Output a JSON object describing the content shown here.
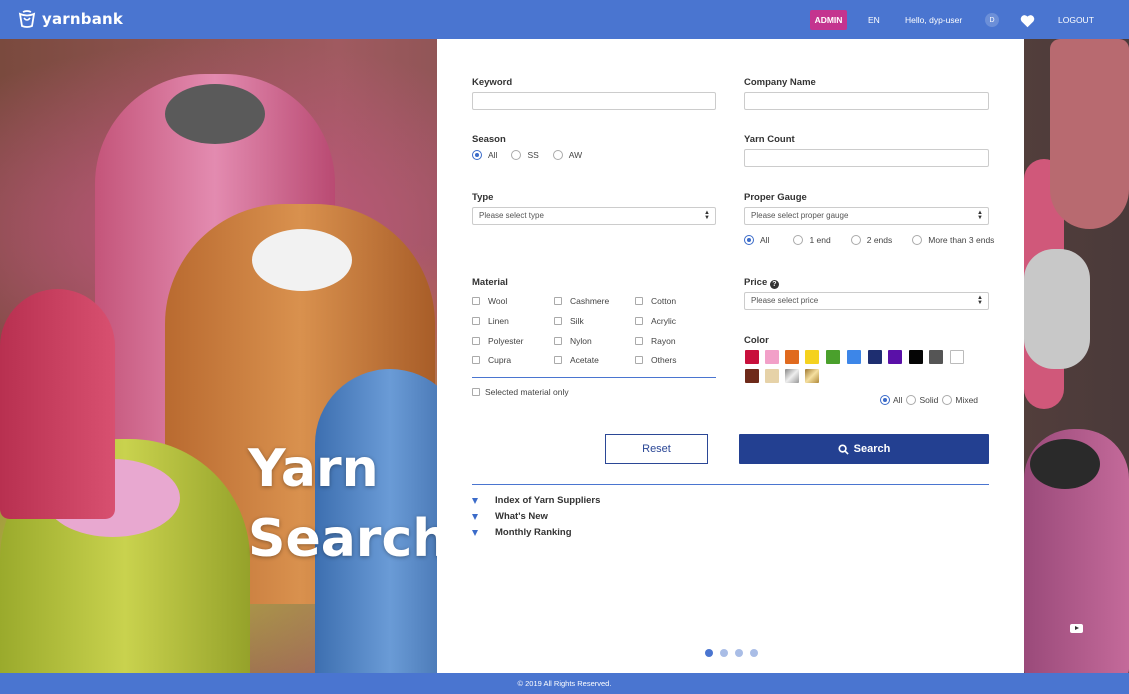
{
  "header": {
    "brand": "yarnbank",
    "admin_label": "ADMIN",
    "lang_label": "EN",
    "greeting": "Hello, dyp-user",
    "avatar_initial": "D",
    "logout_label": "LOGOUT"
  },
  "hero": {
    "title_line1": "Yarn",
    "title_line2": "Search"
  },
  "form": {
    "keyword_label": "Keyword",
    "keyword_value": "",
    "company_label": "Company Name",
    "company_value": "",
    "season_label": "Season",
    "season_options": [
      "All",
      "SS",
      "AW"
    ],
    "season_selected": "All",
    "yarn_count_label": "Yarn Count",
    "yarn_count_value": "",
    "type_label": "Type",
    "type_placeholder": "Please select type",
    "gauge_label": "Proper Gauge",
    "gauge_placeholder": "Please select proper gauge",
    "gauge_options": [
      "All",
      "1 end",
      "2 ends",
      "More than 3 ends"
    ],
    "gauge_selected": "All",
    "material_label": "Material",
    "materials": [
      "Wool",
      "Cashmere",
      "Cotton",
      "Linen",
      "Silk",
      "Acrylic",
      "Polyester",
      "Nylon",
      "Rayon",
      "Cupra",
      "Acetate",
      "Others"
    ],
    "selected_material_only": "Selected material only",
    "price_label": "Price",
    "price_placeholder": "Please select price",
    "color_label": "Color",
    "colors": [
      "#c8103c",
      "#f2a0c8",
      "#e06a1e",
      "#f5d21e",
      "#4aa02c",
      "#3d86e8",
      "#1e2e70",
      "#5a10a8",
      "#050505",
      "#555555",
      "#ffffff",
      "#6e2a1a",
      "#e6d2a8",
      "silver",
      "gold"
    ],
    "color_mode_options": [
      "All",
      "Solid",
      "Mixed"
    ],
    "color_mode_selected": "All",
    "reset_label": "Reset",
    "search_label": "Search"
  },
  "links": [
    "Index of Yarn Suppliers",
    "What's New",
    "Monthly Ranking"
  ],
  "carousel": {
    "count": 4,
    "active": 1
  },
  "footer": {
    "copyright": "© 2019 All Rights Reserved."
  }
}
